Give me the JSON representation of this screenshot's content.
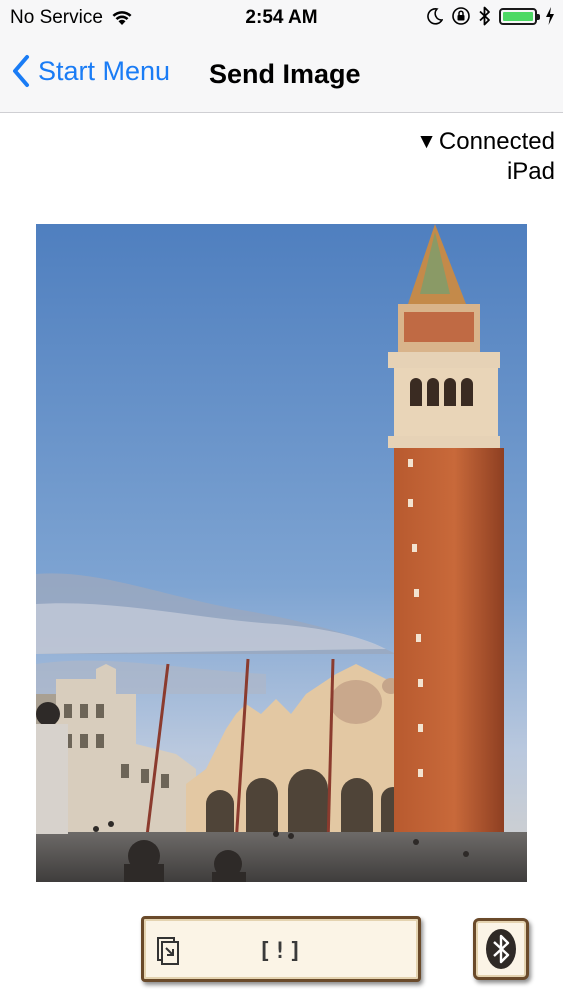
{
  "status_bar": {
    "carrier": "No Service",
    "time": "2:54 AM",
    "icons": [
      "wifi-icon",
      "moon-icon",
      "orientation-lock-icon",
      "bluetooth-icon",
      "battery-icon",
      "charging-icon"
    ],
    "battery_level": 1.0,
    "battery_color": "#4cd964"
  },
  "nav": {
    "back_label": "Start Menu",
    "title": "Send Image",
    "accent_color": "#1a7cf5"
  },
  "connection": {
    "status": "Connected",
    "device": "iPad"
  },
  "photo": {
    "subject": "photo-of-piazza-san-marco-campanile"
  },
  "actions": {
    "send_label": "[!]",
    "send_icon": "send-file-icon",
    "bluetooth_icon": "bluetooth-icon"
  }
}
